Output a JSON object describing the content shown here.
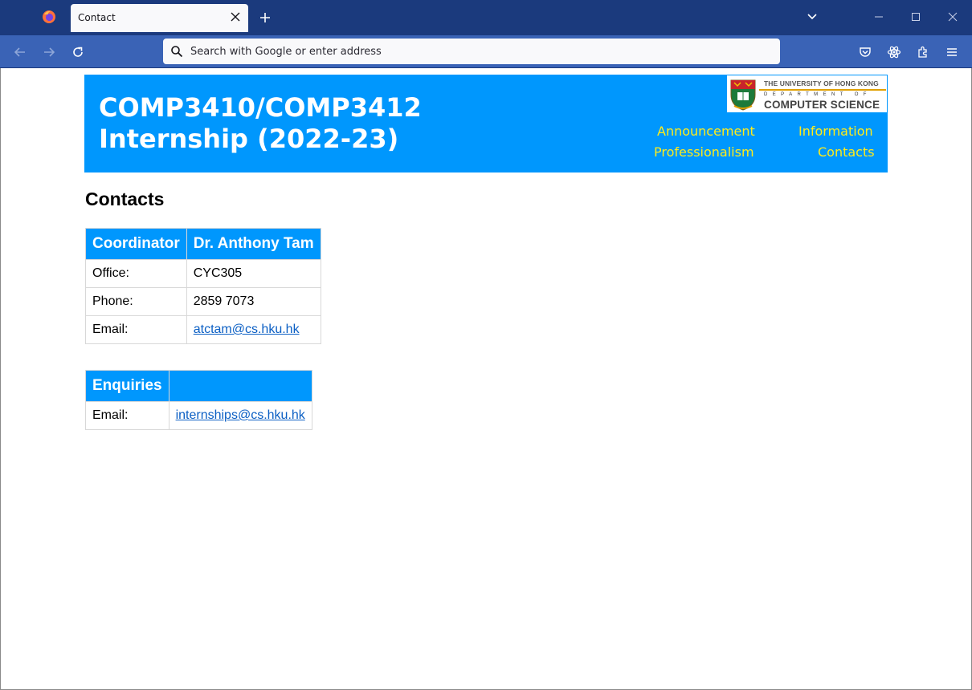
{
  "browser": {
    "tab_title": "Contact",
    "url_placeholder": "Search with Google or enter address"
  },
  "site": {
    "title_line1": "COMP3410/COMP3412",
    "title_line2": "Internship (2022-23)",
    "logo": {
      "line1": "THE UNIVERSITY OF HONG KONG",
      "line2": "DEPARTMENT OF",
      "line3": "COMPUTER SCIENCE"
    },
    "nav": {
      "announcement": "Announcement",
      "information": "Information",
      "professionalism": "Professionalism",
      "contacts": "Contacts"
    }
  },
  "page": {
    "heading": "Contacts",
    "coordinator_table": {
      "header_left": "Coordinator",
      "header_right": "Dr. Anthony Tam",
      "rows": [
        {
          "label": "Office:",
          "value": "CYC305"
        },
        {
          "label": "Phone:",
          "value": "2859 7073"
        },
        {
          "label": "Email:",
          "value": "atctam@cs.hku.hk"
        }
      ]
    },
    "enquiries_table": {
      "header_left": "Enquiries",
      "header_right": "",
      "rows": [
        {
          "label": "Email:",
          "value": "internships@cs.hku.hk"
        }
      ]
    }
  },
  "colors": {
    "banner": "#0097fd",
    "nav_link": "#ffec1a",
    "tabbar": "#1b3a7d",
    "toolbar": "#3a63b6"
  }
}
